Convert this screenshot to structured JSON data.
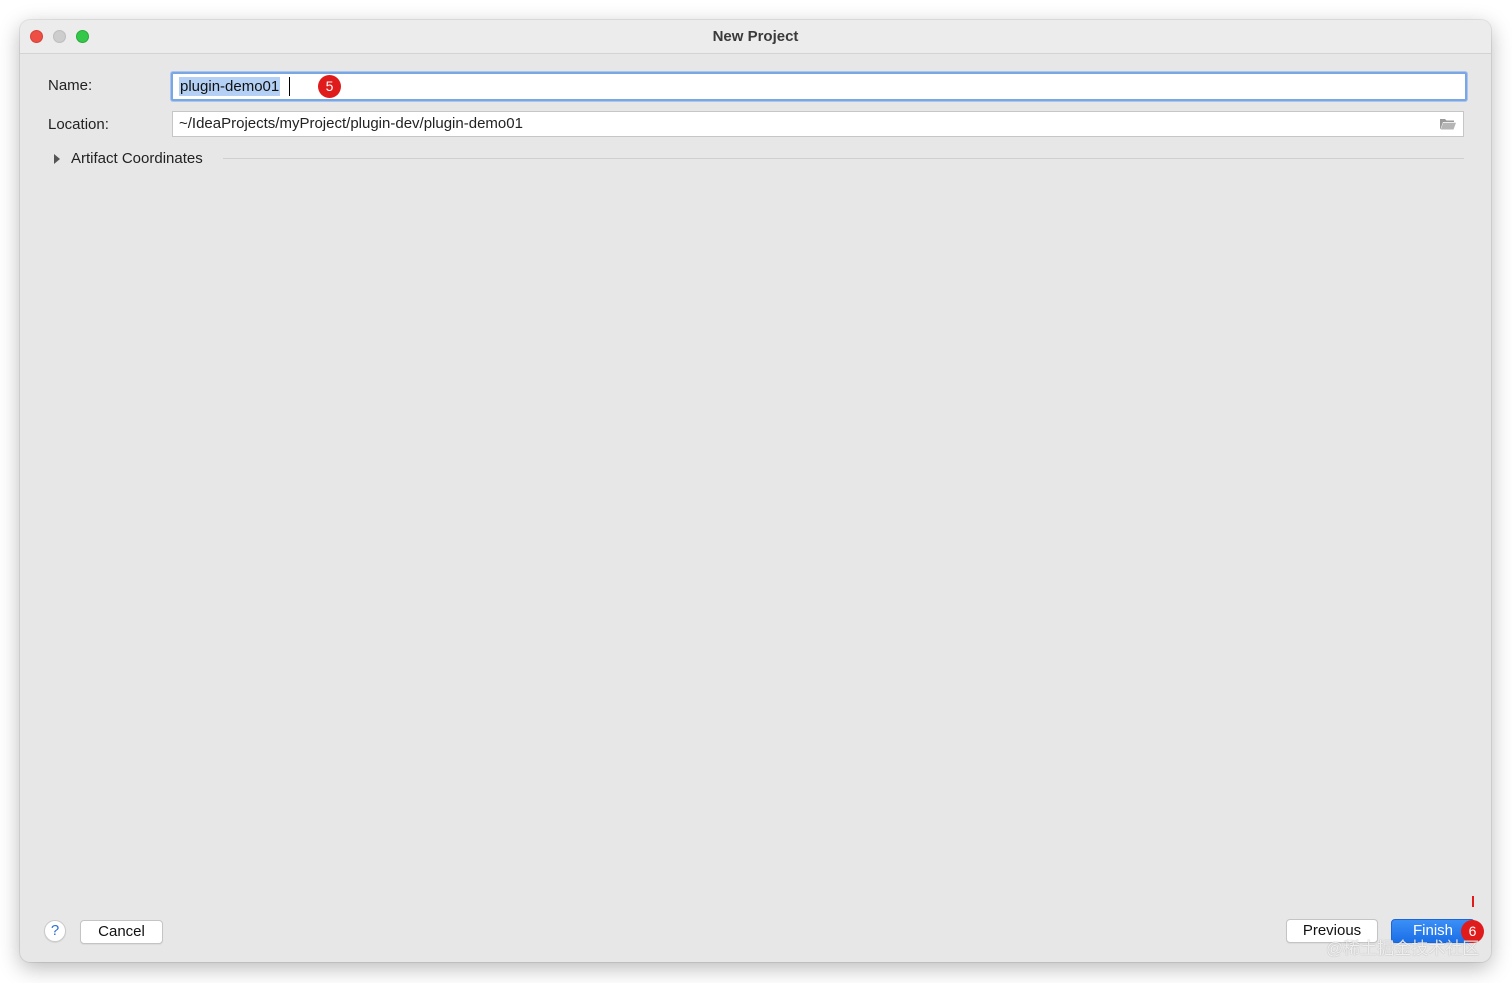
{
  "window": {
    "title": "New Project"
  },
  "form": {
    "name_label": "Name:",
    "name_value": "plugin-demo01",
    "location_label": "Location:",
    "location_value": "~/IdeaProjects/myProject/plugin-dev/plugin-demo01",
    "artifact_section_label": "Artifact Coordinates"
  },
  "annotations": {
    "step5": "5",
    "step6": "6"
  },
  "footer": {
    "help_label": "?",
    "cancel_label": "Cancel",
    "previous_label": "Previous",
    "finish_label": "Finish"
  },
  "watermark": "@稀土掘金技术社区",
  "icons": {
    "folder": "folder-icon",
    "expand": "chevron-right-icon",
    "help": "help-icon"
  },
  "colors": {
    "accent": "#1b6fe8",
    "badge": "#e01b1b",
    "focus_ring": "#7aa7e3",
    "selection": "#b4d1f5"
  }
}
